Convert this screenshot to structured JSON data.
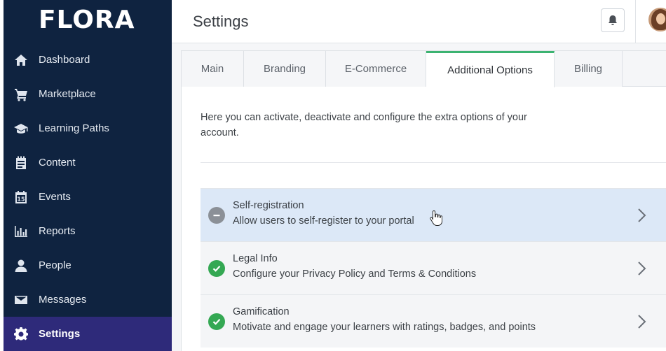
{
  "brand": {
    "logo_text": "FLORA"
  },
  "sidebar": {
    "items": [
      {
        "label": "Dashboard",
        "icon": "home-icon"
      },
      {
        "label": "Marketplace",
        "icon": "cart-icon"
      },
      {
        "label": "Learning Paths",
        "icon": "graduation-cap-icon"
      },
      {
        "label": "Content",
        "icon": "notebook-icon"
      },
      {
        "label": "Events",
        "icon": "calendar-icon"
      },
      {
        "label": "Reports",
        "icon": "bar-chart-icon"
      },
      {
        "label": "People",
        "icon": "person-icon"
      },
      {
        "label": "Messages",
        "icon": "envelope-icon"
      },
      {
        "label": "Settings",
        "icon": "gear-icon",
        "active": true
      }
    ],
    "calendar_day": "15"
  },
  "header": {
    "title": "Settings"
  },
  "tabs": [
    {
      "label": "Main"
    },
    {
      "label": "Branding"
    },
    {
      "label": "E-Commerce"
    },
    {
      "label": "Additional Options",
      "active": true
    },
    {
      "label": "Billing"
    }
  ],
  "main": {
    "intro": "Here you can activate, deactivate and configure the extra options of your account.",
    "options": [
      {
        "title": "Self-registration",
        "description": "Allow users to self-register to your portal",
        "status": "disabled"
      },
      {
        "title": "Legal Info",
        "description": "Configure your Privacy Policy and Terms & Conditions",
        "status": "enabled"
      },
      {
        "title": "Gamification",
        "description": "Motivate and engage your learners with ratings, badges, and points",
        "status": "enabled"
      }
    ]
  },
  "colors": {
    "sidebar_bg": "#0f2340",
    "sidebar_active": "#2e2a7a",
    "tab_accent": "#3cb371",
    "enabled_green": "#34a853",
    "disabled_gray": "#8b9097",
    "row_highlight": "#dce8f7"
  }
}
